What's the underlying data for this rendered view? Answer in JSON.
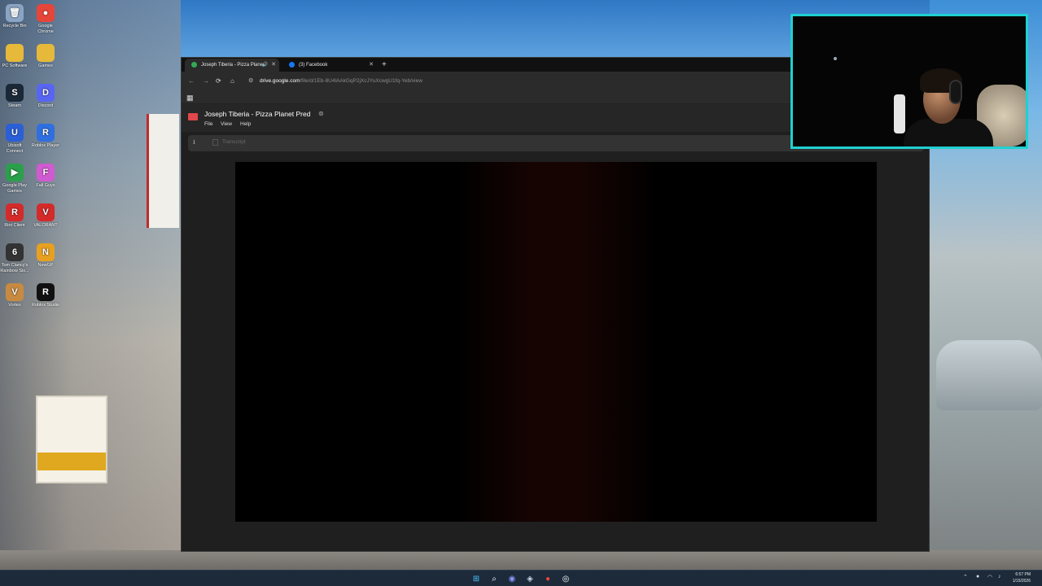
{
  "desktop": {
    "icons": [
      {
        "label": "Recycle Bin",
        "glyph": "🗑",
        "color": "#8aa4c4"
      },
      {
        "label": "Google Chrome",
        "glyph": "●",
        "color": "#e6453a"
      },
      {
        "label": "PC Software",
        "glyph": "",
        "color": "#e6b93a"
      },
      {
        "label": "Games",
        "glyph": "",
        "color": "#e6b93a"
      },
      {
        "label": "Steam",
        "glyph": "S",
        "color": "#1b2838"
      },
      {
        "label": "Discord",
        "glyph": "D",
        "color": "#5865f2"
      },
      {
        "label": "Ubisoft Connect",
        "glyph": "U",
        "color": "#2a5fd8"
      },
      {
        "label": "Roblox Player",
        "glyph": "R",
        "color": "#2f6fe0"
      },
      {
        "label": "Google Play Games",
        "glyph": "▶",
        "color": "#2aa04a"
      },
      {
        "label": "Fall Guys",
        "glyph": "F",
        "color": "#d05ad0"
      },
      {
        "label": "Riot Client",
        "glyph": "R",
        "color": "#d42a2a"
      },
      {
        "label": "VALORANT",
        "glyph": "V",
        "color": "#d42a2a"
      },
      {
        "label": "Tom Clancy's Rainbow Six...",
        "glyph": "6",
        "color": "#333333"
      },
      {
        "label": "NewGP",
        "glyph": "N",
        "color": "#e8a020"
      },
      {
        "label": "Vortex",
        "glyph": "V",
        "color": "#c88a40"
      },
      {
        "label": "Roblox Studio",
        "glyph": "R",
        "color": "#111111"
      }
    ]
  },
  "browser": {
    "tabs": [
      {
        "title": "Joseph Tiberia - Pizza Plane",
        "favicon_color": "#34a853",
        "active": true,
        "audio": true
      },
      {
        "title": "(3) Facebook",
        "favicon_color": "#1877f2",
        "active": false,
        "audio": false
      }
    ],
    "close_label": "✕",
    "new_tab_label": "+",
    "url_host": "drive.google.com",
    "url_path": "/file/d/1Eb-8U4lAAkGqP2jXcJYuXcwgU1fq-Yeb/view",
    "nav": {
      "back": "←",
      "forward": "→",
      "reload": "⟳",
      "home": "⌂"
    }
  },
  "drive": {
    "title": "Joseph Tiberia - Pizza Planet Pred",
    "menu": [
      "File",
      "View",
      "Help"
    ],
    "transcript_label": "Transcript"
  },
  "taskbar": {
    "time": "6:57 PM",
    "date": "1/15/2026"
  }
}
